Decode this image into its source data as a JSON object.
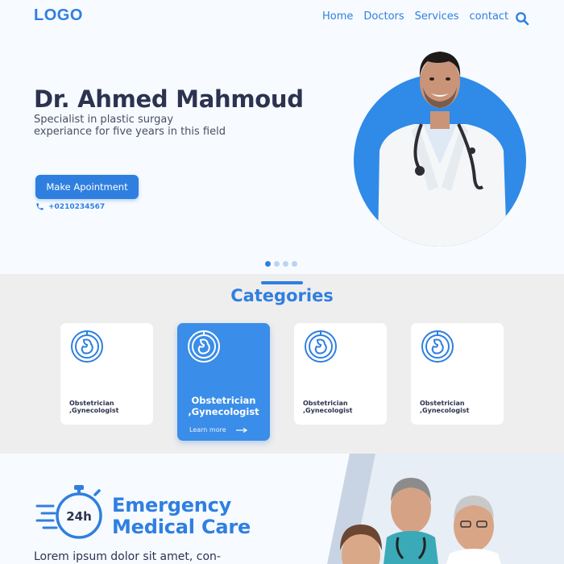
{
  "header": {
    "logo": "LOGO",
    "nav": [
      {
        "label": "Home"
      },
      {
        "label": "Doctors"
      },
      {
        "label": "Services"
      },
      {
        "label": "contact"
      }
    ],
    "search_icon": "search-icon"
  },
  "hero": {
    "title": "Dr. Ahmed Mahmoud",
    "subtitle_line1": "Specialist in plastic surgay",
    "subtitle_line2": "experiance for five years in this field",
    "cta": "Make Apointment",
    "phone": "+0210234567",
    "slides": 4,
    "active_slide": 1
  },
  "categories": {
    "title": "Categories",
    "items": [
      {
        "line1": "Obstetrician",
        "line2": ",Gynecologist"
      },
      {
        "line1": "Obstetrician",
        "line2": ",Gynecologist",
        "more": "Learn more"
      },
      {
        "line1": "Obstetrician",
        "line2": ",Gynecologist"
      },
      {
        "line1": "Obstetrician",
        "line2": ",Gynecologist"
      }
    ]
  },
  "emergency": {
    "badge": "24h",
    "title_line1": "Emergency",
    "title_line2": "Medical Care",
    "text": "Lorem ipsum dolor sit amet, con-"
  },
  "colors": {
    "accent": "#2f7fe0",
    "card_active": "#3a8de8",
    "section_bg": "#efeeee",
    "page_bg": "#f7fbff"
  }
}
